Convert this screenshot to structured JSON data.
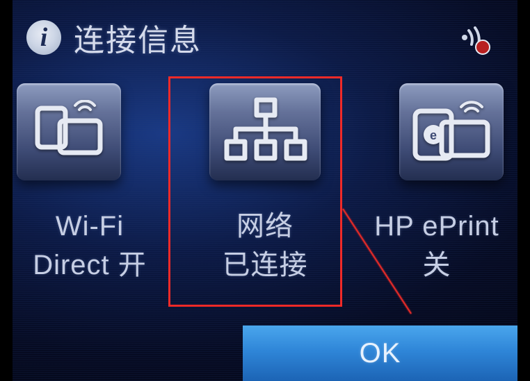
{
  "header": {
    "info_glyph": "i",
    "title": "连接信息"
  },
  "wifi_status": {
    "icon_name": "wireless-signal-error-icon"
  },
  "tiles": [
    {
      "label": "Wi-Fi\nDirect 开",
      "icon": "wifi-direct-icon"
    },
    {
      "label": "网络\n已连接",
      "icon": "ethernet-network-icon"
    },
    {
      "label": "HP ePrint\n关",
      "icon": "hp-eprint-icon"
    }
  ],
  "ok_button": {
    "label": "OK"
  },
  "annotation": {
    "highlight_target_index": 1
  },
  "colors": {
    "highlight": "#f02a28",
    "ok_button": "#2f86d8"
  }
}
